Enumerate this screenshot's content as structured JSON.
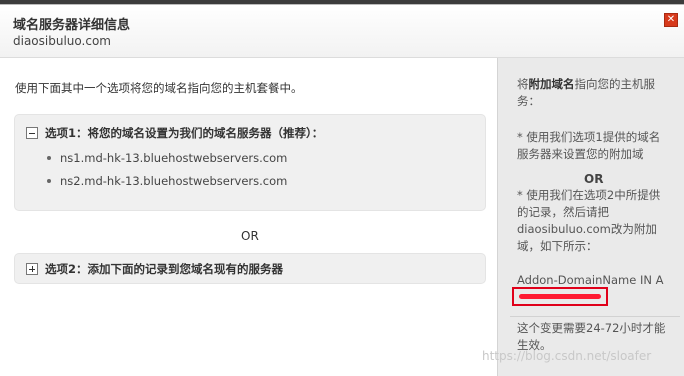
{
  "dialog": {
    "title": "域名服务器详细信息",
    "domain": "diaosibuluo.com",
    "close_symbol": "✕"
  },
  "left_panel": {
    "intro": "使用下面其中一个选项将您的域名指向您的主机套餐中。",
    "option1": {
      "toggle": "collapse",
      "label": "选项1：将您的域名设置为我们的域名服务器（推荐）：",
      "nameservers": [
        "ns1.md-hk-13.bluehostwebservers.com",
        "ns2.md-hk-13.bluehostwebservers.com"
      ]
    },
    "or_label": "OR",
    "option2": {
      "toggle": "expand",
      "label": "选项2：添加下面的记录到您域名现有的服务器"
    }
  },
  "right_panel": {
    "intro_prefix": "将",
    "intro_bold": "附加域名",
    "intro_suffix": "指向您的主机服务：",
    "tip1": "* 使用我们选项1提供的域名服务器来设置您的附加域",
    "or_label": "OR",
    "tip2": "* 使用我们在选项2中所提供的记录，然后请把diaosibuluo.com改为附加域，如下所示：",
    "record": "Addon-DomainName IN A",
    "record_value_redacted": true,
    "note": "这个变更需要24-72小时才能生效。"
  },
  "watermark": "https://blog.csdn.net/sloafer",
  "colors": {
    "close_button": "#d73a1c",
    "redaction": "#ff1b33",
    "right_panel_bg": "#eaeaea",
    "option_panel_bg": "#f0f0f0"
  }
}
